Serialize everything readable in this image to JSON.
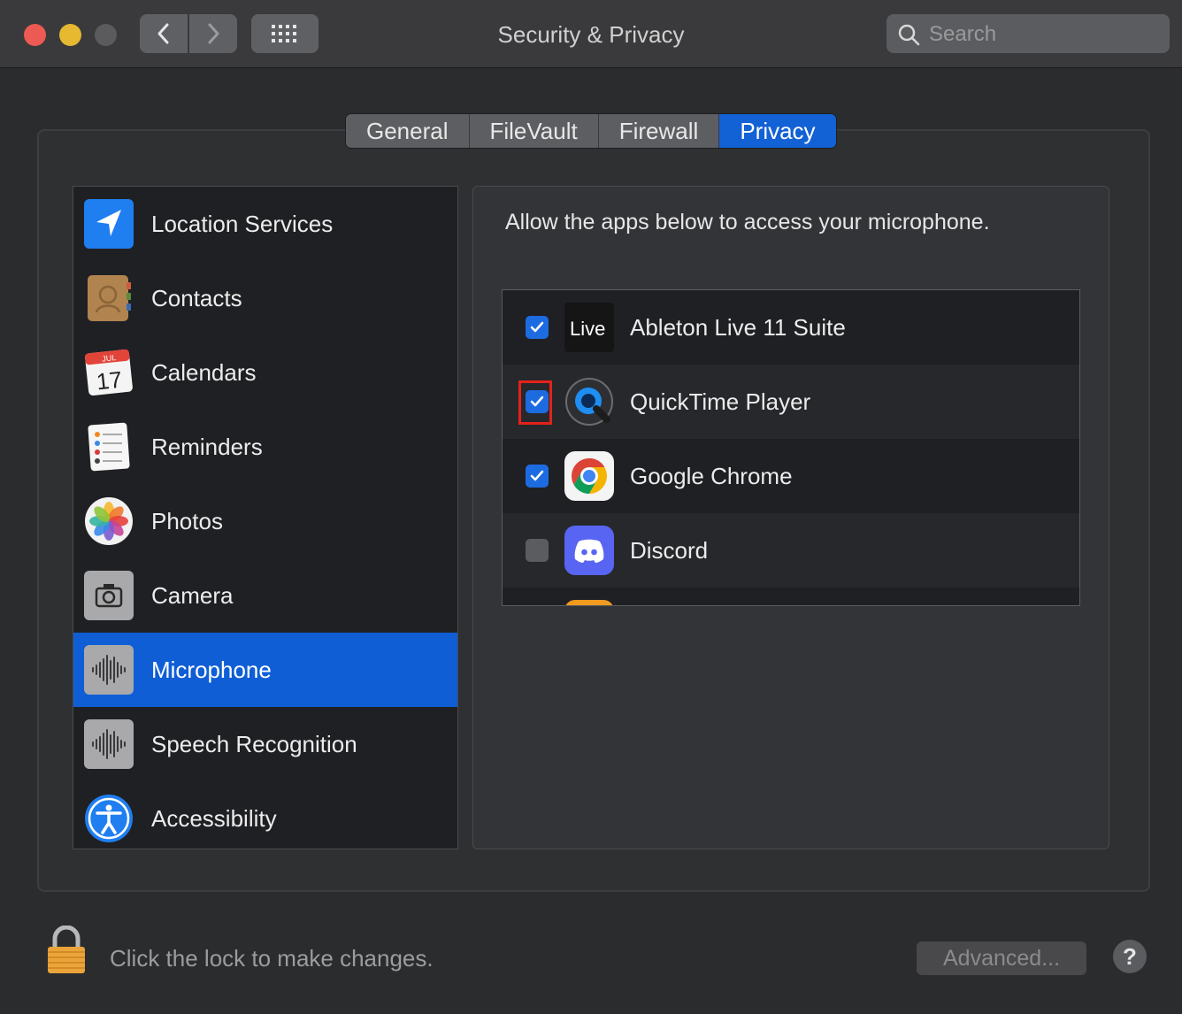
{
  "window": {
    "title": "Security & Privacy"
  },
  "search": {
    "placeholder": "Search"
  },
  "tabs": [
    {
      "label": "General",
      "active": false
    },
    {
      "label": "FileVault",
      "active": false
    },
    {
      "label": "Firewall",
      "active": false
    },
    {
      "label": "Privacy",
      "active": true
    }
  ],
  "sidebar": {
    "items": [
      {
        "label": "Location Services",
        "icon": "location-arrow-icon"
      },
      {
        "label": "Contacts",
        "icon": "contacts-book-icon"
      },
      {
        "label": "Calendars",
        "icon": "calendar-icon",
        "icon_month": "JUL",
        "icon_day": "17"
      },
      {
        "label": "Reminders",
        "icon": "reminders-icon"
      },
      {
        "label": "Photos",
        "icon": "photos-icon"
      },
      {
        "label": "Camera",
        "icon": "camera-icon"
      },
      {
        "label": "Microphone",
        "icon": "microphone-waveform-icon",
        "selected": true
      },
      {
        "label": "Speech Recognition",
        "icon": "speech-waveform-icon"
      },
      {
        "label": "Accessibility",
        "icon": "accessibility-icon"
      }
    ]
  },
  "main": {
    "description": "Allow the apps below to access your microphone.",
    "apps": [
      {
        "name": "Ableton Live 11 Suite",
        "checked": true,
        "icon": "ableton-live-icon",
        "icon_text": "Live"
      },
      {
        "name": "QuickTime Player",
        "checked": true,
        "icon": "quicktime-icon",
        "highlighted": true
      },
      {
        "name": "Google Chrome",
        "checked": true,
        "icon": "chrome-icon"
      },
      {
        "name": "Discord",
        "checked": false,
        "icon": "discord-icon"
      }
    ]
  },
  "footer": {
    "lock_text": "Click the lock to make changes.",
    "advanced_label": "Advanced...",
    "help_label": "?"
  },
  "colors": {
    "accent": "#1261d5",
    "selection": "#0f5ed6",
    "highlight_box": "#e3221c"
  }
}
